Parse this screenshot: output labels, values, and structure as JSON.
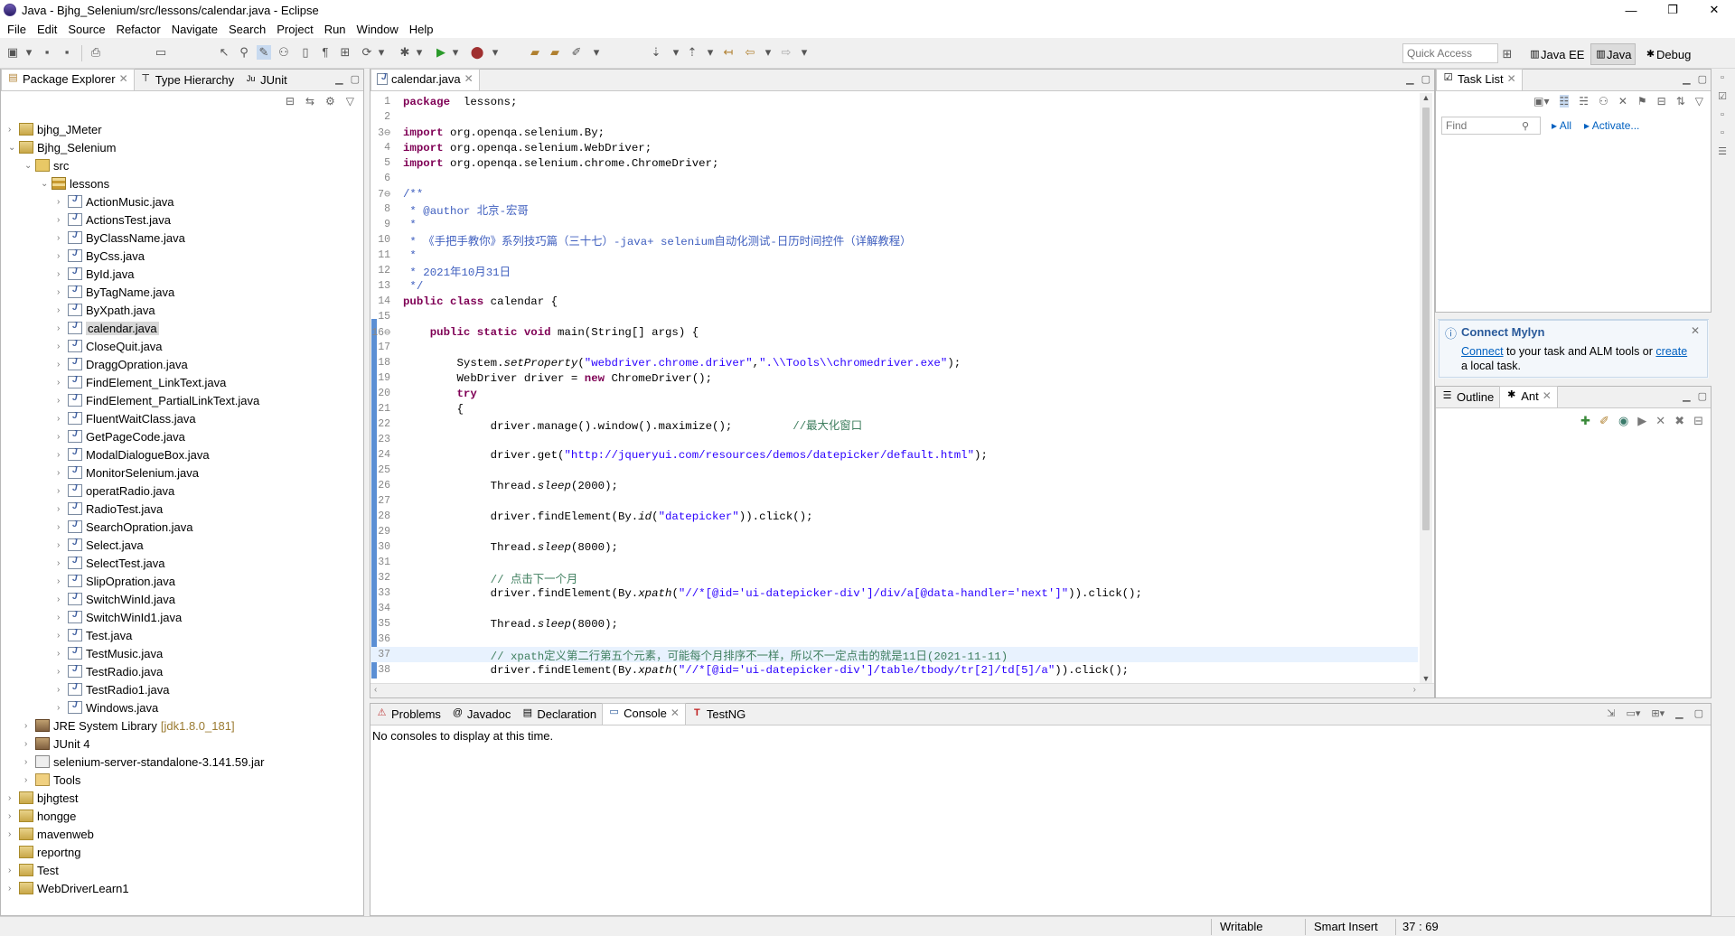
{
  "window": {
    "title": "Java - Bjhg_Selenium/src/lessons/calendar.java - Eclipse",
    "min": "—",
    "max": "❐",
    "close": "✕"
  },
  "menu": [
    "File",
    "Edit",
    "Source",
    "Refactor",
    "Navigate",
    "Search",
    "Project",
    "Run",
    "Window",
    "Help"
  ],
  "toolbar": {
    "quick_access_placeholder": "Quick Access"
  },
  "perspectives": [
    {
      "label": "Java EE"
    },
    {
      "label": "Java"
    },
    {
      "label": "Debug"
    }
  ],
  "left_panel": {
    "tabs": [
      {
        "label": "Package Explorer",
        "active": true
      },
      {
        "label": "Type Hierarchy",
        "active": false
      },
      {
        "label": "JUnit",
        "active": false
      }
    ],
    "tree": [
      {
        "label": "bjhg_JMeter",
        "depth": 0,
        "type": "proj",
        "arrow": "›"
      },
      {
        "label": "Bjhg_Selenium",
        "depth": 0,
        "type": "proj",
        "arrow": "⌄"
      },
      {
        "label": "src",
        "depth": 1,
        "type": "src",
        "arrow": "⌄"
      },
      {
        "label": "lessons",
        "depth": 2,
        "type": "pkg",
        "arrow": "⌄"
      },
      {
        "label": "ActionMusic.java",
        "depth": 3,
        "type": "java",
        "arrow": "›"
      },
      {
        "label": "ActionsTest.java",
        "depth": 3,
        "type": "java",
        "arrow": "›"
      },
      {
        "label": "ByClassName.java",
        "depth": 3,
        "type": "java",
        "arrow": "›"
      },
      {
        "label": "ByCss.java",
        "depth": 3,
        "type": "java",
        "arrow": "›"
      },
      {
        "label": "ById.java",
        "depth": 3,
        "type": "java",
        "arrow": "›"
      },
      {
        "label": "ByTagName.java",
        "depth": 3,
        "type": "java",
        "arrow": "›"
      },
      {
        "label": "ByXpath.java",
        "depth": 3,
        "type": "java",
        "arrow": "›"
      },
      {
        "label": "calendar.java",
        "depth": 3,
        "type": "java",
        "arrow": "›",
        "selected": true
      },
      {
        "label": "CloseQuit.java",
        "depth": 3,
        "type": "java",
        "arrow": "›"
      },
      {
        "label": "DraggOpration.java",
        "depth": 3,
        "type": "java",
        "arrow": "›"
      },
      {
        "label": "FindElement_LinkText.java",
        "depth": 3,
        "type": "java",
        "arrow": "›"
      },
      {
        "label": "FindElement_PartialLinkText.java",
        "depth": 3,
        "type": "java",
        "arrow": "›"
      },
      {
        "label": "FluentWaitClass.java",
        "depth": 3,
        "type": "java",
        "arrow": "›"
      },
      {
        "label": "GetPageCode.java",
        "depth": 3,
        "type": "java",
        "arrow": "›"
      },
      {
        "label": "ModalDialogueBox.java",
        "depth": 3,
        "type": "java",
        "arrow": "›"
      },
      {
        "label": "MonitorSelenium.java",
        "depth": 3,
        "type": "java",
        "arrow": "›"
      },
      {
        "label": "operatRadio.java",
        "depth": 3,
        "type": "java",
        "arrow": "›"
      },
      {
        "label": "RadioTest.java",
        "depth": 3,
        "type": "java",
        "arrow": "›"
      },
      {
        "label": "SearchOpration.java",
        "depth": 3,
        "type": "java",
        "arrow": "›"
      },
      {
        "label": "Select.java",
        "depth": 3,
        "type": "java",
        "arrow": "›"
      },
      {
        "label": "SelectTest.java",
        "depth": 3,
        "type": "java",
        "arrow": "›"
      },
      {
        "label": "SlipOpration.java",
        "depth": 3,
        "type": "java",
        "arrow": "›"
      },
      {
        "label": "SwitchWinId.java",
        "depth": 3,
        "type": "java",
        "arrow": "›"
      },
      {
        "label": "SwitchWinId1.java",
        "depth": 3,
        "type": "java",
        "arrow": "›"
      },
      {
        "label": "Test.java",
        "depth": 3,
        "type": "java",
        "arrow": "›"
      },
      {
        "label": "TestMusic.java",
        "depth": 3,
        "type": "java",
        "arrow": "›"
      },
      {
        "label": "TestRadio.java",
        "depth": 3,
        "type": "java",
        "arrow": "›"
      },
      {
        "label": "TestRadio1.java",
        "depth": 3,
        "type": "java",
        "arrow": "›"
      },
      {
        "label": "Windows.java",
        "depth": 3,
        "type": "java",
        "arrow": "›"
      },
      {
        "label": "JRE System Library",
        "suffix": "[jdk1.8.0_181]",
        "depth": 1,
        "type": "lib",
        "arrow": "›"
      },
      {
        "label": "JUnit 4",
        "depth": 1,
        "type": "lib",
        "arrow": "›"
      },
      {
        "label": "selenium-server-standalone-3.141.59.jar",
        "depth": 1,
        "type": "jar",
        "arrow": "›"
      },
      {
        "label": "Tools",
        "depth": 1,
        "type": "folder",
        "arrow": "›"
      },
      {
        "label": "bjhgtest",
        "depth": 0,
        "type": "proj",
        "arrow": "›"
      },
      {
        "label": "hongge",
        "depth": 0,
        "type": "proj",
        "arrow": "›"
      },
      {
        "label": "mavenweb",
        "depth": 0,
        "type": "proj",
        "arrow": "›"
      },
      {
        "label": "reportng",
        "depth": 0,
        "type": "proj",
        "arrow": ""
      },
      {
        "label": "Test",
        "depth": 0,
        "type": "proj",
        "arrow": "›"
      },
      {
        "label": "WebDriverLearn1",
        "depth": 0,
        "type": "proj",
        "arrow": "›"
      }
    ]
  },
  "editor": {
    "tab": "calendar.java",
    "lines": [
      {
        "n": "1",
        "seg": [
          [
            "kw",
            "package"
          ],
          [
            "",
            "  lessons;"
          ]
        ]
      },
      {
        "n": "2",
        "seg": []
      },
      {
        "n": "3⊖",
        "seg": [
          [
            "kw",
            "import"
          ],
          [
            "",
            " org.openqa.selenium.By;"
          ]
        ]
      },
      {
        "n": "4",
        "seg": [
          [
            "kw",
            "import"
          ],
          [
            "",
            " org.openqa.selenium.WebDriver;"
          ]
        ]
      },
      {
        "n": "5",
        "seg": [
          [
            "kw",
            "import"
          ],
          [
            "",
            " org.openqa.selenium.chrome.ChromeDriver;"
          ]
        ]
      },
      {
        "n": "6",
        "seg": []
      },
      {
        "n": "7⊖",
        "seg": [
          [
            "cm",
            "/**"
          ]
        ]
      },
      {
        "n": "8",
        "seg": [
          [
            "cm",
            " * @author 北京-宏哥"
          ]
        ]
      },
      {
        "n": "9",
        "seg": [
          [
            "cm",
            " *"
          ]
        ]
      },
      {
        "n": "10",
        "seg": [
          [
            "cm",
            " * 《手把手教你》系列技巧篇（三十七）-java+ selenium自动化测试-日历时间控件（详解教程）"
          ]
        ]
      },
      {
        "n": "11",
        "seg": [
          [
            "cm",
            " *"
          ]
        ]
      },
      {
        "n": "12",
        "seg": [
          [
            "cm",
            " * 2021年10月31日"
          ]
        ]
      },
      {
        "n": "13",
        "seg": [
          [
            "cm",
            " */"
          ]
        ]
      },
      {
        "n": "14",
        "seg": [
          [
            "kw",
            "public class"
          ],
          [
            "",
            " calendar {"
          ]
        ]
      },
      {
        "n": "15",
        "seg": []
      },
      {
        "n": "16⊖",
        "seg": [
          [
            "",
            "    "
          ],
          [
            "kw",
            "public static void"
          ],
          [
            "",
            " main(String[] args) {"
          ]
        ]
      },
      {
        "n": "17",
        "seg": []
      },
      {
        "n": "18",
        "seg": [
          [
            "",
            "        System."
          ],
          [
            "ital",
            "setProperty"
          ],
          [
            "",
            "("
          ],
          [
            "str",
            "\"webdriver.chrome.driver\""
          ],
          [
            "",
            ","
          ],
          [
            "str",
            "\".\\\\Tools\\\\chromedriver.exe\""
          ],
          [
            "",
            ");"
          ]
        ]
      },
      {
        "n": "19",
        "seg": [
          [
            "",
            "        WebDriver driver = "
          ],
          [
            "kw",
            "new"
          ],
          [
            "",
            " ChromeDriver();"
          ]
        ]
      },
      {
        "n": "20",
        "seg": [
          [
            "",
            "        "
          ],
          [
            "kw",
            "try"
          ]
        ]
      },
      {
        "n": "21",
        "seg": [
          [
            "",
            "        {"
          ]
        ]
      },
      {
        "n": "22",
        "seg": [
          [
            "",
            "             driver.manage().window().maximize();         "
          ],
          [
            "cm2",
            "//最大化窗口"
          ]
        ]
      },
      {
        "n": "23",
        "seg": []
      },
      {
        "n": "24",
        "seg": [
          [
            "",
            "             driver.get("
          ],
          [
            "str",
            "\"http://jqueryui.com/resources/demos/datepicker/default.html\""
          ],
          [
            "",
            ");"
          ]
        ]
      },
      {
        "n": "25",
        "seg": []
      },
      {
        "n": "26",
        "seg": [
          [
            "",
            "             Thread."
          ],
          [
            "ital",
            "sleep"
          ],
          [
            "",
            "(2000);"
          ]
        ]
      },
      {
        "n": "27",
        "seg": []
      },
      {
        "n": "28",
        "seg": [
          [
            "",
            "             driver.findElement(By."
          ],
          [
            "ital",
            "id"
          ],
          [
            "",
            "("
          ],
          [
            "str",
            "\"datepicker\""
          ],
          [
            "",
            ")).click();"
          ]
        ]
      },
      {
        "n": "29",
        "seg": []
      },
      {
        "n": "30",
        "seg": [
          [
            "",
            "             Thread."
          ],
          [
            "ital",
            "sleep"
          ],
          [
            "",
            "(8000);"
          ]
        ]
      },
      {
        "n": "31",
        "seg": []
      },
      {
        "n": "32",
        "seg": [
          [
            "",
            "             "
          ],
          [
            "cm2",
            "// 点击下一个月"
          ]
        ]
      },
      {
        "n": "33",
        "seg": [
          [
            "",
            "             driver.findElement(By."
          ],
          [
            "ital",
            "xpath"
          ],
          [
            "",
            "("
          ],
          [
            "str",
            "\"//*[@id='ui-datepicker-div']/div/a[@data-handler='next']\""
          ],
          [
            "",
            ")).click();"
          ]
        ]
      },
      {
        "n": "34",
        "seg": []
      },
      {
        "n": "35",
        "seg": [
          [
            "",
            "             Thread."
          ],
          [
            "ital",
            "sleep"
          ],
          [
            "",
            "(8000);"
          ]
        ]
      },
      {
        "n": "36",
        "seg": []
      },
      {
        "n": "37",
        "seg": [
          [
            "",
            "             "
          ],
          [
            "cm2",
            "// xpath定义第二行第五个元素，可能每个月排序不一样，所以不一定点击的就是11日(2021-11-11)"
          ]
        ],
        "hl": true
      },
      {
        "n": "38",
        "seg": [
          [
            "",
            "             driver.findElement(By."
          ],
          [
            "ital",
            "xpath"
          ],
          [
            "",
            "("
          ],
          [
            "str",
            "\"//*[@id='ui-datepicker-div']/table/tbody/tr[2]/td[5]/a\""
          ],
          [
            "",
            ")).click();"
          ]
        ]
      }
    ]
  },
  "task_panel": {
    "tab": "Task List",
    "find_placeholder": "Find",
    "all_label": "All",
    "activate_label": "Activate..."
  },
  "mylyn": {
    "title": "Connect Mylyn",
    "connect": "Connect",
    "middle": " to your task and ALM tools or ",
    "create": "create",
    "tail": "a local task."
  },
  "outline_panel": {
    "tabs": [
      "Outline",
      "Ant"
    ]
  },
  "console_panel": {
    "tabs": [
      "Problems",
      "Javadoc",
      "Declaration",
      "Console",
      "TestNG"
    ],
    "active": "Console",
    "message": "No consoles to display at this time."
  },
  "status": {
    "writable": "Writable",
    "insert": "Smart Insert",
    "position": "37 : 69"
  }
}
